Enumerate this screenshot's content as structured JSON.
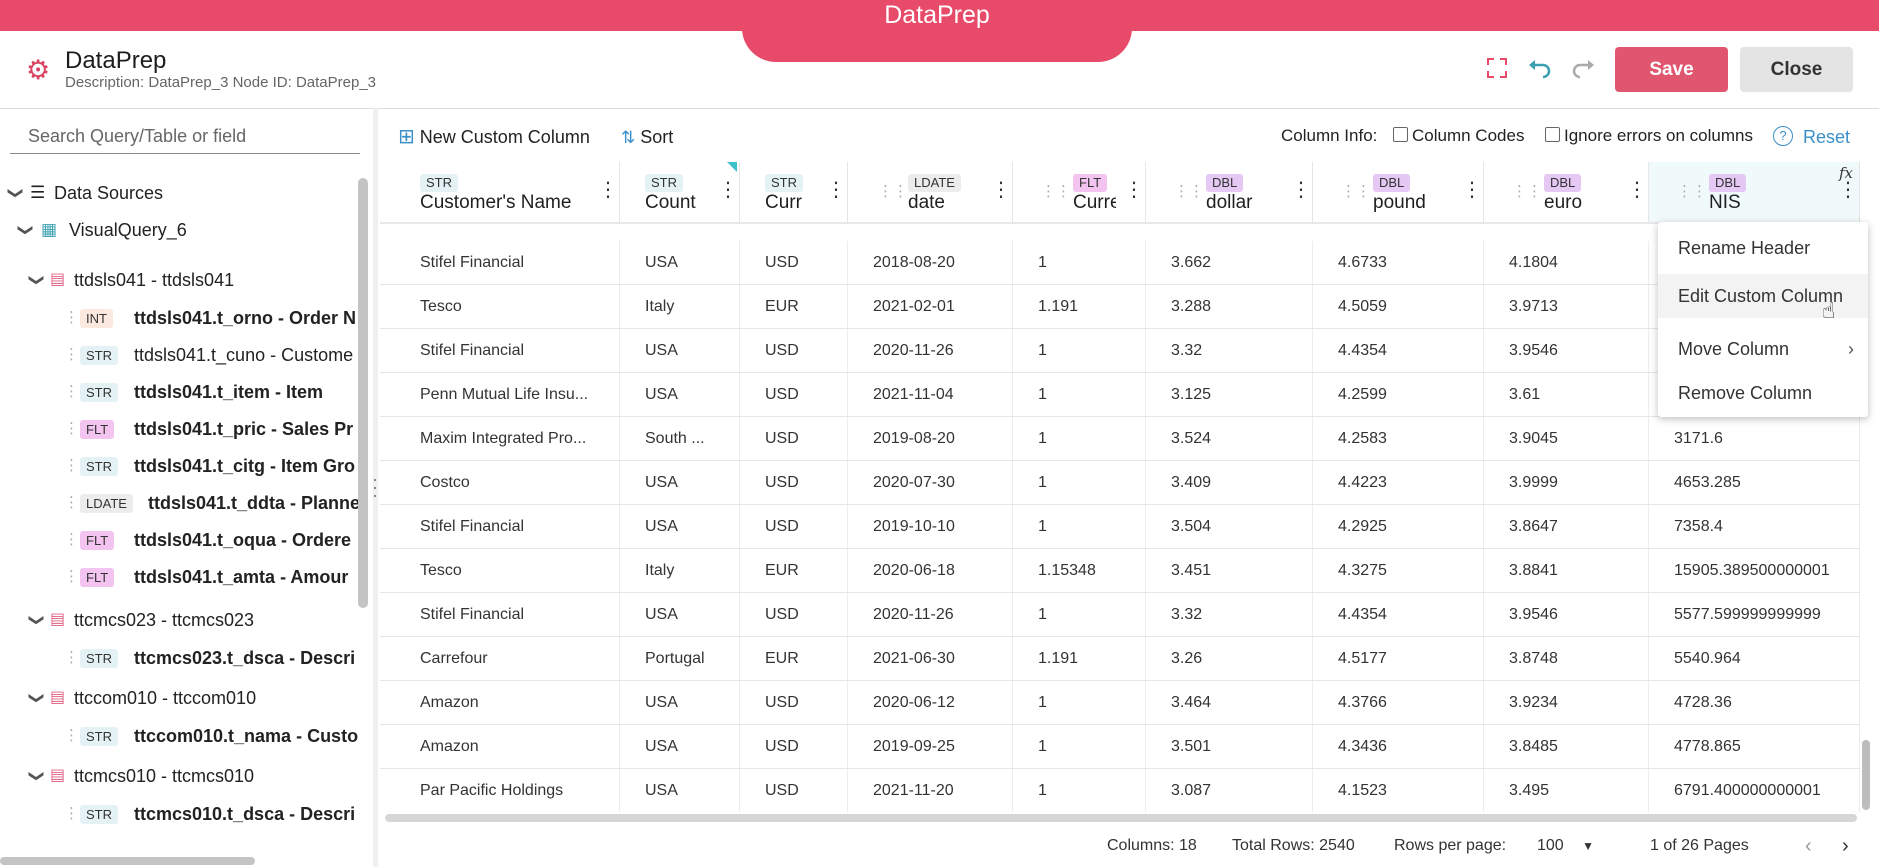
{
  "banner": {
    "title": "DataPrep"
  },
  "header": {
    "title": "DataPrep",
    "description": "Description: DataPrep_3 Node ID: DataPrep_3",
    "save_label": "Save",
    "close_label": "Close"
  },
  "colors": {
    "accent": "#e84a6a",
    "save": "#e0566f",
    "link": "#3a8fc8"
  },
  "search": {
    "placeholder": "Search Query/Table or field"
  },
  "tree": {
    "data_sources": "Data Sources",
    "query": "VisualQuery_6",
    "tables": [
      {
        "label": "ttdsls041 - ttdsls041"
      },
      {
        "label": "ttcmcs023 - ttcmcs023"
      },
      {
        "label": "ttccom010 - ttccom010"
      },
      {
        "label": "ttcmcs010 - ttcmcs010"
      }
    ],
    "fields": [
      {
        "type": "INT",
        "label": "ttdsls041.t_orno - Order N",
        "bold": true
      },
      {
        "type": "STR",
        "label": "ttdsls041.t_cuno - Custome",
        "bold": false
      },
      {
        "type": "STR",
        "label": "ttdsls041.t_item - Item",
        "bold": true
      },
      {
        "type": "FLT",
        "label": "ttdsls041.t_pric - Sales Pr",
        "bold": true
      },
      {
        "type": "STR",
        "label": "ttdsls041.t_citg - Item Gro",
        "bold": true
      },
      {
        "type": "LDATE",
        "label": "ttdsls041.t_ddta - Planne",
        "bold": true
      },
      {
        "type": "FLT",
        "label": "ttdsls041.t_oqua - Ordere",
        "bold": true
      },
      {
        "type": "FLT",
        "label": "ttdsls041.t_amta - Amour",
        "bold": true
      },
      {
        "type": "STR",
        "label": "ttcmcs023.t_dsca - Descri",
        "bold": true
      },
      {
        "type": "STR",
        "label": "ttccom010.t_nama - Custo",
        "bold": true
      },
      {
        "type": "STR",
        "label": "ttcmcs010.t_dsca - Descri",
        "bold": true
      }
    ]
  },
  "toolbar": {
    "new_custom_column": "New Custom Column",
    "sort": "Sort",
    "column_info": "Column Info:",
    "column_codes": "Column Codes",
    "ignore_errors": "Ignore errors on columns",
    "reset": "Reset"
  },
  "columns": [
    {
      "type": "STR",
      "name": "Customer's Name"
    },
    {
      "type": "STR",
      "name": "Count"
    },
    {
      "type": "STR",
      "name": "Curr"
    },
    {
      "type": "LDATE",
      "name": "date"
    },
    {
      "type": "FLT",
      "name": "Currenc"
    },
    {
      "type": "DBL",
      "name": "dollar"
    },
    {
      "type": "DBL",
      "name": "pound"
    },
    {
      "type": "DBL",
      "name": "euro"
    },
    {
      "type": "DBL",
      "name": "NIS"
    }
  ],
  "rows": [
    [
      "Stifel Financial",
      "USA",
      "USD",
      "2018-08-20",
      "1",
      "3.662",
      "4.6733",
      "4.1804",
      ""
    ],
    [
      "Tesco",
      "Italy",
      "EUR",
      "2021-02-01",
      "1.191",
      "3.288",
      "4.5059",
      "3.9713",
      ""
    ],
    [
      "Stifel Financial",
      "USA",
      "USD",
      "2020-11-26",
      "1",
      "3.32",
      "4.4354",
      "3.9546",
      ""
    ],
    [
      "Penn Mutual Life Insu...",
      "USA",
      "USD",
      "2021-11-04",
      "1",
      "3.125",
      "4.2599",
      "3.61",
      ""
    ],
    [
      "Maxim Integrated Pro...",
      "South ...",
      "USD",
      "2019-08-20",
      "1",
      "3.524",
      "4.2583",
      "3.9045",
      "3171.6"
    ],
    [
      "Costco",
      "USA",
      "USD",
      "2020-07-30",
      "1",
      "3.409",
      "4.4223",
      "3.9999",
      "4653.285"
    ],
    [
      "Stifel Financial",
      "USA",
      "USD",
      "2019-10-10",
      "1",
      "3.504",
      "4.2925",
      "3.8647",
      "7358.4"
    ],
    [
      "Tesco",
      "Italy",
      "EUR",
      "2020-06-18",
      "1.15348",
      "3.451",
      "4.3275",
      "3.8841",
      "15905.389500000001"
    ],
    [
      "Stifel Financial",
      "USA",
      "USD",
      "2020-11-26",
      "1",
      "3.32",
      "4.4354",
      "3.9546",
      "5577.599999999999"
    ],
    [
      "Carrefour",
      "Portugal",
      "EUR",
      "2021-06-30",
      "1.191",
      "3.26",
      "4.5177",
      "3.8748",
      "5540.964"
    ],
    [
      "Amazon",
      "USA",
      "USD",
      "2020-06-12",
      "1",
      "3.464",
      "4.3766",
      "3.9234",
      "4728.36"
    ],
    [
      "Amazon",
      "USA",
      "USD",
      "2019-09-25",
      "1",
      "3.501",
      "4.3436",
      "3.8485",
      "4778.865"
    ],
    [
      "Par Pacific Holdings",
      "USA",
      "USD",
      "2021-11-20",
      "1",
      "3.087",
      "4.1523",
      "3.495",
      "6791.400000000001"
    ]
  ],
  "context_menu": {
    "items": [
      "Rename Header",
      "Edit Custom Column",
      "Move Column",
      "Remove Column"
    ]
  },
  "footer": {
    "columns": "Columns: 18",
    "total_rows": "Total Rows: 2540",
    "rows_per_page_label": "Rows per page:",
    "rows_per_page_value": "100",
    "pages": "1 of 26 Pages"
  }
}
